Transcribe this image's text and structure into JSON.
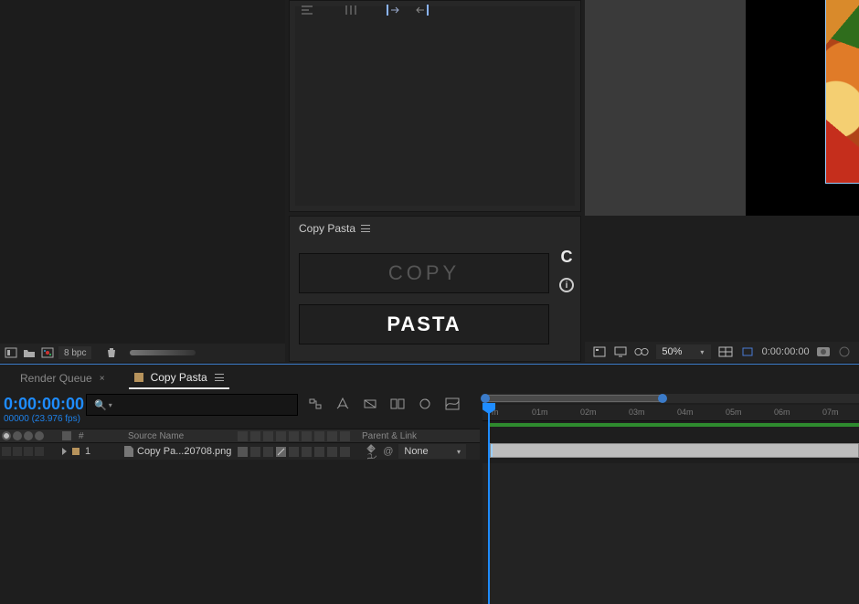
{
  "project_footer": {
    "bpc": "8 bpc"
  },
  "copy_pasta_panel": {
    "title": "Copy Pasta",
    "copy_label": "COPY",
    "pasta_label": "PASTA"
  },
  "viewer": {
    "zoom": "50%",
    "timecode": "0:00:00:00"
  },
  "tabs": {
    "render_queue": "Render Queue",
    "comp_name": "Copy Pasta"
  },
  "timeline": {
    "current_time": "0:00:00:00",
    "current_frame_fps": "00000 (23.976 fps)",
    "columns": {
      "source_name": "Source Name",
      "parent_link": "Parent & Link",
      "hash": "#"
    },
    "layer1": {
      "index": "1",
      "name": "Copy Pa...20708.png",
      "parent": "None"
    },
    "ruler": [
      "m",
      "01m",
      "02m",
      "03m",
      "04m",
      "05m",
      "06m",
      "07m"
    ]
  }
}
